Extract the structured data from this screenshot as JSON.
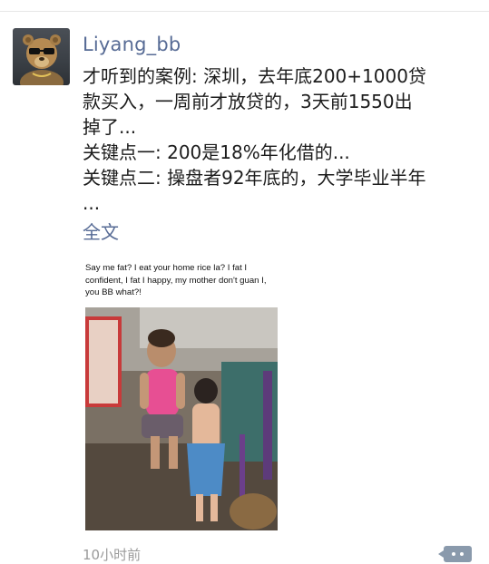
{
  "moment": {
    "username": "Liyang_bb",
    "post_lines": [
      "才听到的案例: 深圳，去年底200+1000贷",
      "款买入，一周前才放贷的，3天前1550出",
      "掉了...",
      "关键点一: 200是18%年化借的...",
      "关键点二: 操盘者92年底的，大学毕业半年",
      "..."
    ],
    "full_text_link": "全文",
    "image": {
      "caption": "Say me fat?  I eat your home rice la?  I fat I confident,  I fat I happy,  my mother don't guan I, you BB what?!"
    },
    "timestamp": "10小时前"
  },
  "icons": {
    "avatar": "teddy-bear-avatar",
    "comment": "comment-dots-icon"
  },
  "colors": {
    "link": "#576b95",
    "text": "#1c1c1c",
    "muted": "#9a9a9a",
    "comment_button": "#8a9aac"
  }
}
